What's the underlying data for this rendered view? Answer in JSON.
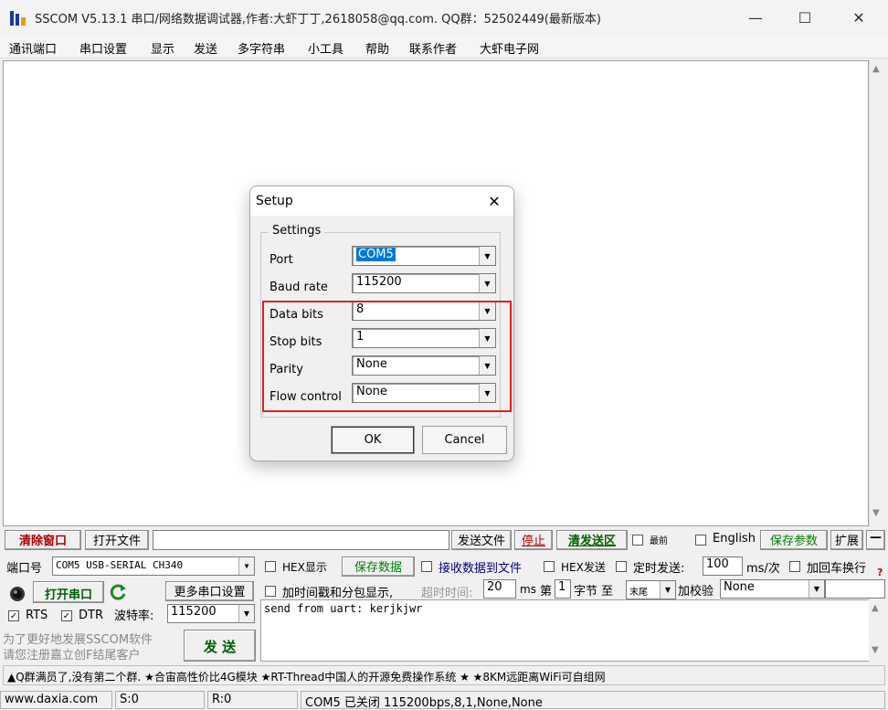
{
  "window": {
    "title": "SSCOM V5.13.1 串口/网络数据调试器,作者:大虾丁丁,2618058@qq.com. QQ群：52502449(最新版本)",
    "minimize": "—",
    "maximize": "☐",
    "close": "✕"
  },
  "menu": [
    "通讯端口",
    "串口设置",
    "显示",
    "发送",
    "多字符串",
    "小工具",
    "帮助",
    "联系作者",
    "大虾电子网"
  ],
  "toolbar": {
    "clear_window": "清除窗口",
    "open_file": "打开文件",
    "send_file": "发送文件",
    "stop": "停止",
    "clear_send": "清发送区",
    "topmost": "最前",
    "english": "English",
    "save_params": "保存参数",
    "expand": "扩展",
    "collapse": "—"
  },
  "port_row": {
    "port_label": "端口号",
    "port_value": "COM5 USB-SERIAL CH340",
    "hex_display": "HEX显示",
    "save_data": "保存数据",
    "recv_to_file": "接收数据到文件",
    "hex_send": "HEX发送",
    "timed_send": "定时发送:",
    "interval": "100",
    "interval_unit": "ms/次",
    "add_crlf": "加回车换行"
  },
  "open_row": {
    "open_port": "打开串口",
    "more_settings": "更多串口设置",
    "timestamp": "加时间戳和分包显示,",
    "timeout_label": "超时时间:",
    "timeout_value": "20",
    "timeout_unit": "ms",
    "byte_label1": "第",
    "byte_index": "1",
    "byte_label2": "字节 至",
    "byte_end": "末尾",
    "checksum_label": "加校验",
    "checksum_value": "None"
  },
  "rts_row": {
    "rts": "RTS",
    "dtr": "DTR",
    "baud_label": "波特率:",
    "baud_value": "115200"
  },
  "promo": {
    "line1": "为了更好地发展SSCOM软件",
    "line2": "请您注册嘉立创F结尾客户",
    "send_button": "发 送"
  },
  "send_text": "send from uart: kerjkjwr",
  "ticker": "▲Q群满员了,没有第二个群. ★合宙高性价比4G模块 ★RT-Thread中国人的开源免费操作系统 ★ ★8KM远距离WiFi可自组网",
  "status": {
    "website": "www.daxia.com",
    "send_count": "S:0",
    "recv_count": "R:0",
    "port_state": "COM5 已关闭  115200bps,8,1,None,None"
  },
  "dialog": {
    "title": "Setup",
    "group": "Settings",
    "fields": [
      {
        "label": "Port",
        "value": "COM5"
      },
      {
        "label": "Baud rate",
        "value": "115200"
      },
      {
        "label": "Data bits",
        "value": "8"
      },
      {
        "label": "Stop bits",
        "value": "1"
      },
      {
        "label": "Parity",
        "value": "None"
      },
      {
        "label": "Flow control",
        "value": "None"
      }
    ],
    "ok": "OK",
    "cancel": "Cancel"
  },
  "colors": {
    "highlight": "#e02020",
    "selected_bg": "#0078d7",
    "clear_window_text": "#b00000",
    "save_green": "#008000"
  }
}
